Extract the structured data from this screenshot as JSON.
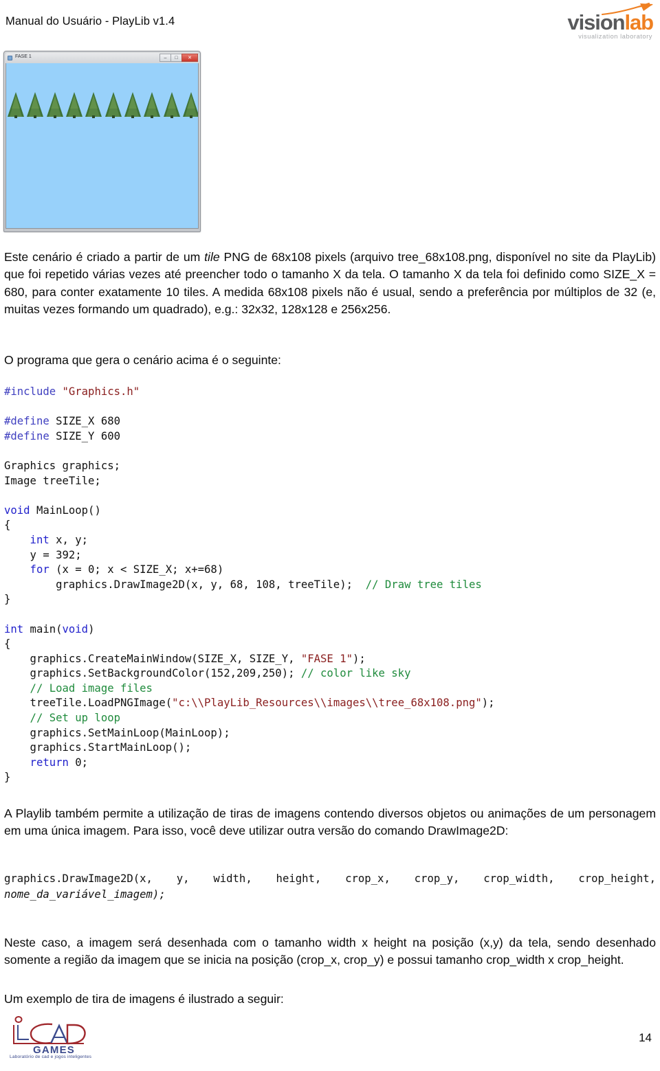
{
  "header": {
    "title": "Manual do Usuário - PlayLib v1.4",
    "logo": {
      "word_primary": "vision",
      "word_accent": "lab",
      "subtitle": "visualization laboratory",
      "accent_color": "#ef8022",
      "primary_color": "#58595b"
    }
  },
  "screenshot": {
    "window_title": "FASE 1",
    "minimize_glyph": "–",
    "maximize_glyph": "□",
    "close_glyph": "✕",
    "background_color": "#98d1fa",
    "tile_count": 10,
    "tile_label": "tree_68x108.png"
  },
  "paragraphs": {
    "p1_a": "Este cenário é criado a partir de um ",
    "p1_italic": "tile",
    "p1_b": " PNG de 68x108 pixels (arquivo tree_68x108.png, disponível no site da PlayLib) que foi repetido várias vezes até preencher todo o tamanho X da tela. O tamanho X da tela foi definido como SIZE_X = 680, para conter exatamente 10 tiles. A medida 68x108 pixels não é usual, sendo a preferência por múltiplos de 32 (e, muitas vezes formando um quadrado), e.g.: 32x32, 128x128 e 256x256.",
    "p2": "O programa que gera o cenário acima é o seguinte:",
    "p3": "A Playlib também permite a utilização de tiras de imagens contendo diversos objetos ou animações de um personagem em uma única imagem. Para isso, você deve utilizar outra versão do comando DrawImage2D:",
    "p4": "Neste caso, a imagem será desenhada com o tamanho width x height na posição (x,y) da tela, sendo desenhado somente a região da imagem que se inicia na posição (crop_x, crop_y) e possui tamanho crop_width x crop_height.",
    "p5": "Um exemplo de tira de imagens é ilustrado a seguir:"
  },
  "code_block": {
    "l_include_kw": "#include",
    "l_include_str": " \"Graphics.h\"",
    "l_def1_kw": "#define",
    "l_def1_rest": " SIZE_X 680",
    "l_def2_kw": "#define",
    "l_def2_rest": " SIZE_Y 600",
    "l_decl1": "Graphics graphics;",
    "l_decl2": "Image treeTile;",
    "l_void_kw": "void",
    "l_void_rest": " MainLoop()",
    "l_open1": "{",
    "l_int_kw": "    int",
    "l_int_rest": " x, y;",
    "l_y": "    y = 392;",
    "l_for_kw": "    for",
    "l_for_rest": " (x = 0; x < SIZE_X; x+=68)",
    "l_draw": "        graphics.DrawImage2D(x, y, 68, 108, treeTile);  ",
    "l_draw_cmt": "// Draw tree tiles",
    "l_close1": "}",
    "l_int_main_kw": "int",
    "l_int_main_mid": " main(",
    "l_int_main_void": "void",
    "l_int_main_end": ")",
    "l_open2": "{",
    "l_cmw_a": "    graphics.CreateMainWindow(SIZE_X, SIZE_Y, ",
    "l_cmw_str": "\"FASE 1\"",
    "l_cmw_b": ");",
    "l_sbc": "    graphics.SetBackgroundColor(152,209,250); ",
    "l_sbc_cmt": "// color like sky",
    "l_cmt_load": "    // Load image files",
    "l_png_a": "    treeTile.LoadPNGImage(",
    "l_png_str": "\"c:\\\\PlayLib_Resources\\\\images\\\\tree_68x108.png\"",
    "l_png_b": ");",
    "l_cmt_setup": "    // Set up loop",
    "l_sml": "    graphics.SetMainLoop(MainLoop);",
    "l_stml": "    graphics.StartMainLoop();",
    "l_ret_kw": "    return",
    "l_ret_rest": " 0;",
    "l_close2": "}"
  },
  "code_signature": {
    "line1": "graphics.DrawImage2D(x, y, width, height, crop_x, crop_y, crop_width, crop_height,",
    "line2": "nome_da_variável_imagem);"
  },
  "footer": {
    "logo_word": "GAMES",
    "logo_sub": "Laboratório de cad e jogos inteligentes",
    "logo_primary_color": "#a0282d",
    "logo_accent_color": "#3b4a8c",
    "page_number": "14"
  }
}
